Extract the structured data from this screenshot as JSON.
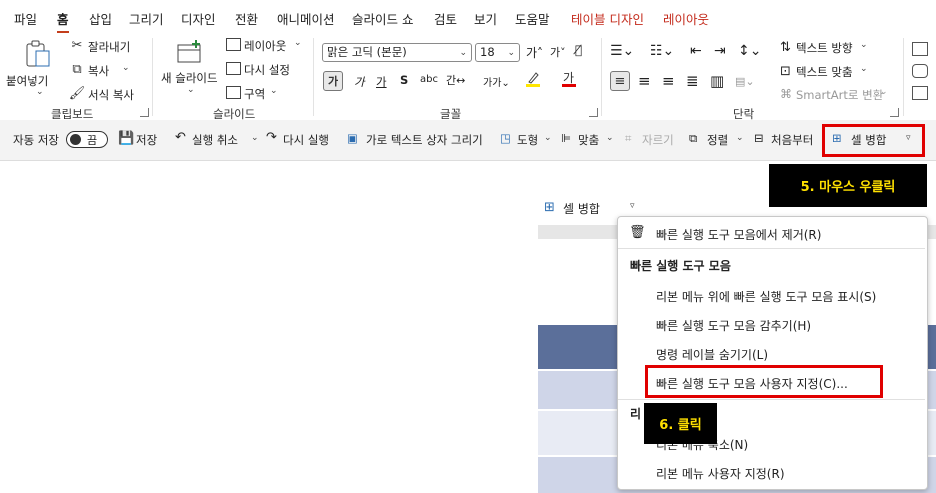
{
  "tabs": [
    "파일",
    "홈",
    "삽입",
    "그리기",
    "디자인",
    "전환",
    "애니메이션",
    "슬라이드 쇼",
    "검토",
    "보기",
    "도움말",
    "테이블 디자인",
    "레이아웃"
  ],
  "ribbon": {
    "clipboard": {
      "paste": "붙여넣기",
      "cut": "잘라내기",
      "copy": "복사",
      "format_painter": "서식 복사",
      "label": "클립보드"
    },
    "slides": {
      "new_slide": "새 슬라이드",
      "layout": "레이아웃",
      "reset": "다시 설정",
      "section": "구역",
      "label": "슬라이드"
    },
    "font": {
      "font_name": "맑은 고딕 (본문)",
      "font_size": "18",
      "bold": "가",
      "italic": "가",
      "underline": "가",
      "strike": "S",
      "label": "글꼴"
    },
    "paragraph": {
      "text_direction": "텍스트 방향",
      "align_text": "텍스트 맞춤",
      "smartart": "SmartArt로 변환",
      "label": "단락"
    }
  },
  "qat": {
    "autosave": "자동 저장",
    "toggle_state": "끔",
    "save": "저장",
    "undo": "실행 취소",
    "redo": "다시 실행",
    "textbox": "가로 텍스트 상자 그리기",
    "shapes": "도형",
    "align": "맞춤",
    "crop": "자르기",
    "arrange": "정렬",
    "from_start": "처음부터",
    "merge_cells": "셀 병합"
  },
  "callouts": {
    "step5": "5. 마우스 우클릭",
    "step6": "6. 클릭"
  },
  "floating_merge": "셀 병합",
  "context_menu": {
    "remove": "빠른 실행 도구 모음에서 제거(R)",
    "header": "빠른 실행 도구 모음",
    "show_above": "리본 메뉴 위에 빠른 실행 도구 모음 표시(S)",
    "hide": "빠른 실행 도구 모음 감추기(H)",
    "hide_labels": "명령 레이블 숨기기(L)",
    "customize": "빠른 실행 도구 모음 사용자 지정(C)...",
    "ribbon_header": "리",
    "collapse_ribbon": "리본 메뉴 축소(N)",
    "customize_ribbon": "리본 메뉴 사용자 지정(R)"
  },
  "colors": {
    "accent_red": "#e00000",
    "callout_bg": "#000000",
    "callout_text": "#ffe000",
    "table_header": "#5b6f9a",
    "table_band": "#cfd5e8"
  }
}
